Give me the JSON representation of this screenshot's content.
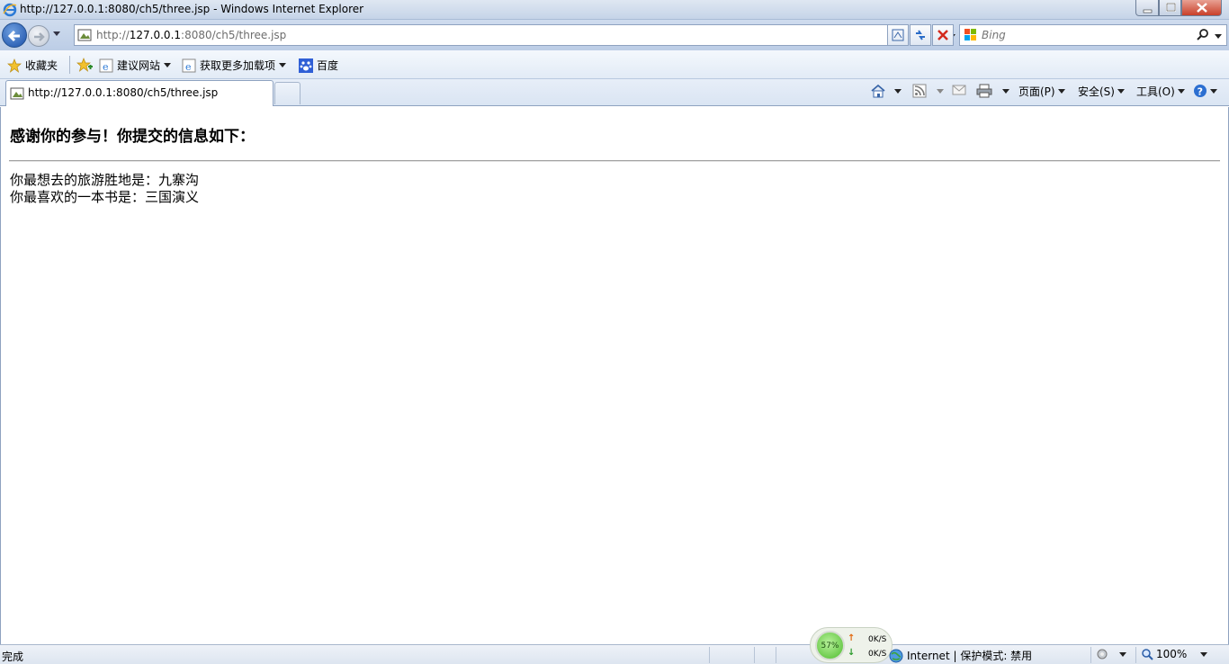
{
  "window": {
    "title": "http://127.0.0.1:8080/ch5/three.jsp - Windows Internet Explorer"
  },
  "address_bar": {
    "url_prefix": "http://",
    "url_host": "127.0.0.1",
    "url_rest": ":8080/ch5/three.jsp"
  },
  "search": {
    "placeholder": "Bing"
  },
  "favorites_bar": {
    "favorites_label": "收藏夹",
    "suggested_sites_label": "建议网站",
    "addons_label": "获取更多加载项",
    "baidu_label": "百度"
  },
  "tabs": [
    {
      "label": "http://127.0.0.1:8080/ch5/three.jsp",
      "active": true
    }
  ],
  "command_bar": {
    "page_label": "页面(P)",
    "safety_label": "安全(S)",
    "tools_label": "工具(O)"
  },
  "content": {
    "heading": "感谢你的参与！你提交的信息如下：",
    "destination_line": "你最想去的旅游胜地是：九寨沟",
    "book_line": "你最喜欢的一本书是：三国演义"
  },
  "status_bar": {
    "status_text": "完成",
    "network_percent": "57%",
    "upload_rate": "0K/S",
    "download_rate": "0K/S",
    "zone_text": "Internet | 保护模式: 禁用",
    "zoom": "100%"
  },
  "colors": {
    "chrome_blue": "#c5d4e8",
    "close_red": "#c9402a",
    "gauge_green": "#4dbb2d"
  }
}
